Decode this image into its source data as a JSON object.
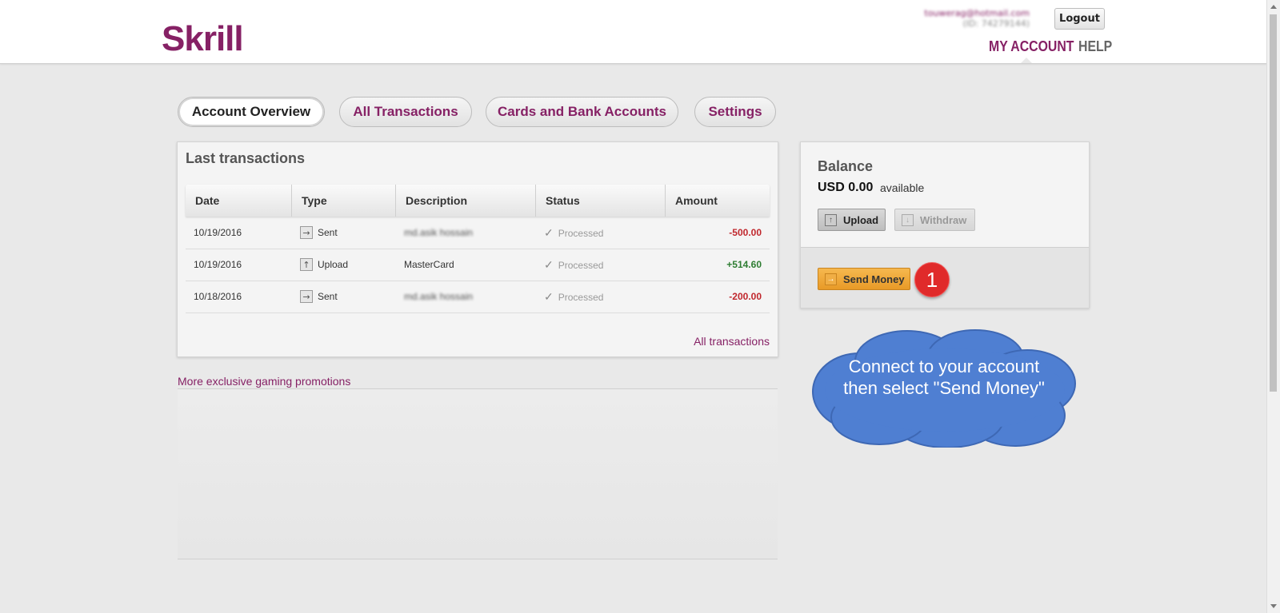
{
  "header": {
    "logo": "Skrill",
    "user_email": "touwerag@hotmail.com",
    "user_id": "(ID: 74279144)",
    "logout_label": "Logout",
    "nav": {
      "my_account": "MY ACCOUNT",
      "help": "HELP"
    }
  },
  "tabs": [
    {
      "label": "Account Overview",
      "active": true
    },
    {
      "label": "All Transactions",
      "active": false
    },
    {
      "label": "Cards and Bank Accounts",
      "active": false
    },
    {
      "label": "Settings",
      "active": false
    }
  ],
  "transactions": {
    "title": "Last transactions",
    "columns": [
      "Date",
      "Type",
      "Description",
      "Status",
      "Amount"
    ],
    "rows": [
      {
        "date": "10/19/2016",
        "type": "Sent",
        "type_icon": "arrow-right-icon",
        "description": "md.asik hossain",
        "status": "Processed",
        "amount": "-500.00"
      },
      {
        "date": "10/19/2016",
        "type": "Upload",
        "type_icon": "arrow-up-icon",
        "description": "MasterCard",
        "status": "Processed",
        "amount": "+514.60"
      },
      {
        "date": "10/18/2016",
        "type": "Sent",
        "type_icon": "arrow-right-icon",
        "description": "md.asik hossain",
        "status": "Processed",
        "amount": "-200.00"
      }
    ],
    "all_link": "All transactions"
  },
  "promotions_link": "More exclusive gaming promotions",
  "balance": {
    "title": "Balance",
    "amount": "USD 0.00",
    "available": "available",
    "upload_label": "Upload",
    "withdraw_label": "Withdraw",
    "send_label": "Send Money"
  },
  "annotation": {
    "step_number": "1",
    "cloud_text": "Connect to your account then select \"Send Money\""
  },
  "colors": {
    "brand": "#862165",
    "negative": "#c0272d",
    "positive": "#2e7d32",
    "send_button": "#f0a93b",
    "badge": "#e02a2a",
    "cloud": "#4a78c8"
  }
}
